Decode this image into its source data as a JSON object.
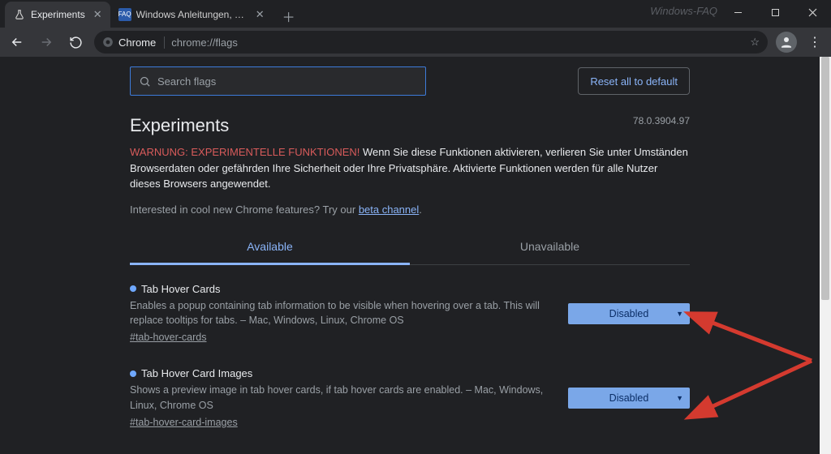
{
  "window": {
    "tabs": [
      {
        "title": "Experiments",
        "active": true
      },
      {
        "title": "Windows Anleitungen, Tipps & T",
        "active": false
      }
    ],
    "watermark": "Windows-FAQ"
  },
  "toolbar": {
    "chip_label": "Chrome",
    "url": "chrome://flags"
  },
  "search": {
    "placeholder": "Search flags"
  },
  "reset_label": "Reset all to default",
  "page": {
    "title": "Experiments",
    "version": "78.0.3904.97",
    "warning_label": "WARNUNG: EXPERIMENTELLE FUNKTIONEN!",
    "warning_body": "Wenn Sie diese Funktionen aktivieren, verlieren Sie unter Umständen Browserdaten oder gefährden Ihre Sicherheit oder Ihre Privatsphäre. Aktivierte Funktionen werden für alle Nutzer dieses Browsers angewendet.",
    "beta_pre": "Interested in cool new Chrome features? Try our ",
    "beta_link": "beta channel",
    "tabs": {
      "available": "Available",
      "unavailable": "Unavailable"
    }
  },
  "flags": [
    {
      "title": "Tab Hover Cards",
      "desc": "Enables a popup containing tab information to be visible when hovering over a tab. This will replace tooltips for tabs. – Mac, Windows, Linux, Chrome OS",
      "anchor": "#tab-hover-cards",
      "value": "Disabled"
    },
    {
      "title": "Tab Hover Card Images",
      "desc": "Shows a preview image in tab hover cards, if tab hover cards are enabled. – Mac, Windows, Linux, Chrome OS",
      "anchor": "#tab-hover-card-images",
      "value": "Disabled"
    }
  ]
}
